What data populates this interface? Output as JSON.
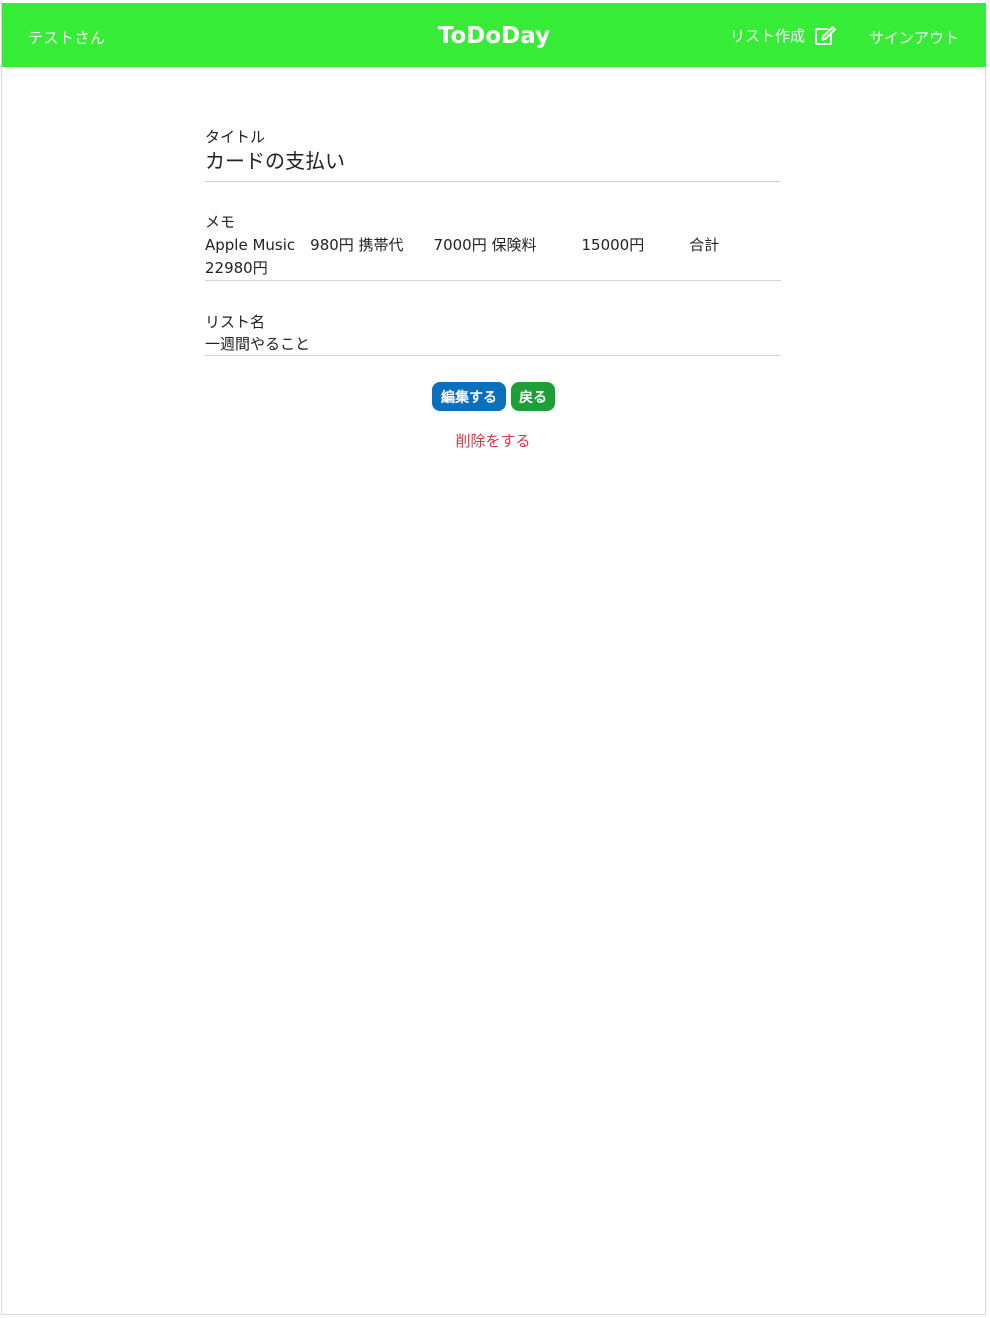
{
  "colors": {
    "accent": "#37ec37",
    "primary": "#0a6fbd",
    "success": "#1d9e37",
    "danger": "#dc3545"
  },
  "header": {
    "user_name": "テストさん",
    "brand": "ToDoDay",
    "create_list_label": "リスト作成",
    "create_list_icon": "edit-icon",
    "signout_label": "サインアウト"
  },
  "detail": {
    "title_label": "タイトル",
    "title_value": "カードの支払い",
    "memo_label": "メモ",
    "memo_value": "Apple Music　980円 携帯代　　7000円 保険料　　　15000円　　　合計　　　　　　　　22980円",
    "list_label": "リスト名",
    "list_value": "一週間やること"
  },
  "actions": {
    "edit_label": "編集する",
    "back_label": "戻る",
    "delete_label": "削除をする"
  }
}
